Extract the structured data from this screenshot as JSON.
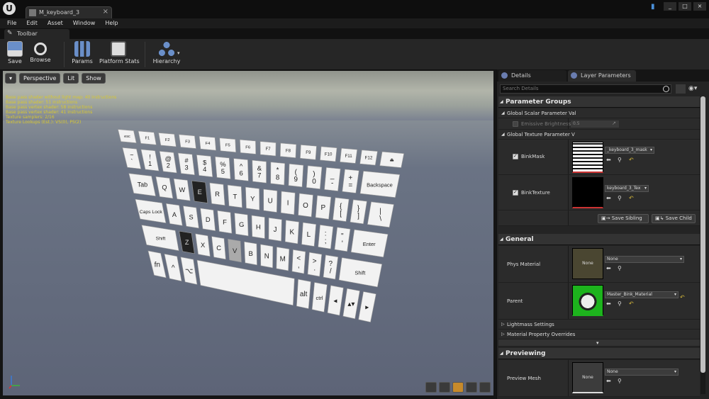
{
  "window": {
    "tab_title": "M_keyboard_3",
    "buttons": [
      "_",
      "□",
      "×"
    ]
  },
  "menu": [
    "File",
    "Edit",
    "Asset",
    "Window",
    "Help"
  ],
  "toolbar_tab": "Toolbar",
  "toolbar": {
    "save": "Save",
    "browse": "Browse",
    "params": "Params",
    "platform_stats": "Platform Stats",
    "hierarchy": "Hierarchy"
  },
  "viewport": {
    "perspective": "Perspective",
    "lit": "Lit",
    "show": "Show",
    "stats": [
      "Base pass shader without light map: 40 instructions",
      "Base pass shader: 51 instructions",
      "Base pass vertex shader: 58 instructions",
      "Base pass vertex shader: 41 instructions",
      "Texture samplers: 2/16",
      "Texture Lookups (Est.): VS(0), PS(2)"
    ],
    "keyboard": {
      "row1": [
        "esc",
        "F1",
        "F2",
        "F3",
        "F4",
        "F5",
        "F6",
        "F7",
        "F8",
        "F9",
        "F10",
        "F11",
        "F12",
        "⏏"
      ],
      "row2": [
        "~\n`",
        "!\n1",
        "@\n2",
        "#\n3",
        "$\n4",
        "%\n5",
        "^\n6",
        "&\n7",
        "*\n8",
        "(\n9",
        ")\n0",
        "_\n-",
        "+\n=",
        "Backspace"
      ],
      "row3": [
        "Tab",
        "Q",
        "W",
        "E",
        "R",
        "T",
        "Y",
        "U",
        "I",
        "O",
        "P",
        "{\n[",
        "}\n]",
        "|\n\\"
      ],
      "row4": [
        "Caps Lock",
        "A",
        "S",
        "D",
        "F",
        "G",
        "H",
        "J",
        "K",
        "L",
        ":\n;",
        "\"\n'",
        "Enter"
      ],
      "row5": [
        "Shift",
        "Z",
        "X",
        "C",
        "V",
        "B",
        "N",
        "M",
        "<\n,",
        ">\n.",
        "?\n/",
        "Shift"
      ],
      "row6": [
        "fn",
        "^",
        "⌥",
        "",
        "alt",
        "ctrl",
        "◂",
        "▴▾",
        "▸"
      ]
    }
  },
  "details_panel": {
    "tab_details": "Details",
    "tab_layer": "Layer Parameters",
    "search_placeholder": "Search Details",
    "parameter_groups": "Parameter Groups",
    "global_scalar": "Global Scalar Parameter Val",
    "emissive_brightness": "Emissive Brightness",
    "emissive_value": "0.5",
    "global_texture": "Global Texture Parameter V",
    "binkmask_label": "BinkMask",
    "binkmask_value": "_keyboard_3_mask",
    "binktexture_label": "BinkTexture",
    "binktexture_value": "keyboard_3_Tex",
    "save_sibling": "Save Sibling",
    "save_child": "Save Child",
    "general": "General",
    "phys_material_label": "Phys Material",
    "phys_material_thumb": "None",
    "phys_material_value": "None",
    "parent_label": "Parent",
    "parent_value": "Master_Bink_Material",
    "lightmass_settings": "Lightmass Settings",
    "material_property_overrides": "Material Property Overrides",
    "previewing": "Previewing",
    "preview_mesh_label": "Preview Mesh",
    "preview_mesh_thumb": "None",
    "preview_mesh_value": "None"
  },
  "colors": {
    "accent_orange": "#c78a2b",
    "stats_yellow": "#d8c830",
    "parent_green": "#1db31d"
  }
}
